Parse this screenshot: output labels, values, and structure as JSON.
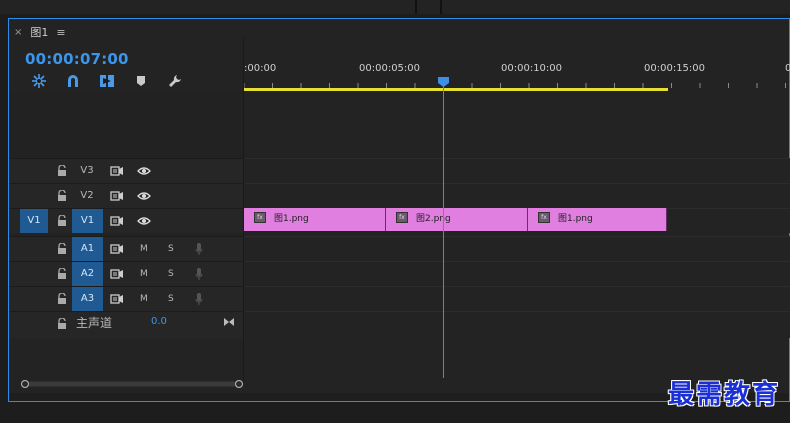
{
  "panel": {
    "close_glyph": "×",
    "title": "图1",
    "menu_glyph": "≡",
    "timecode": "00:00:07:00"
  },
  "toolbar": {
    "tools": [
      "snap-insert-icon",
      "magnet-snap-icon",
      "linked-selection-icon",
      "add-marker-icon",
      "wrench-settings-icon"
    ]
  },
  "ruler": {
    "labels": [
      ":00:00",
      "00:00:05:00",
      "00:00:10:00",
      "00:00:15:00",
      "0"
    ],
    "playhead_time": "00:00:07:00"
  },
  "tracks": {
    "video": [
      {
        "id": "V3",
        "source": "",
        "selected": false
      },
      {
        "id": "V2",
        "source": "",
        "selected": false
      },
      {
        "id": "V1",
        "source": "V1",
        "selected": true
      }
    ],
    "audio": [
      {
        "id": "A1",
        "m": "M",
        "s": "S"
      },
      {
        "id": "A2",
        "m": "M",
        "s": "S"
      },
      {
        "id": "A3",
        "m": "M",
        "s": "S"
      }
    ],
    "master": {
      "label": "主声道",
      "value": "0.0"
    }
  },
  "clips": [
    {
      "name": "图1.png",
      "fx": "fx"
    },
    {
      "name": "图2.png",
      "fx": "fx"
    },
    {
      "name": "图1.png",
      "fx": "fx"
    }
  ],
  "watermark": "最需教育",
  "colors": {
    "accent": "#2d8ceb",
    "clip": "#e07fe0",
    "workarea": "#e8e030",
    "track_selected": "#205a92"
  }
}
